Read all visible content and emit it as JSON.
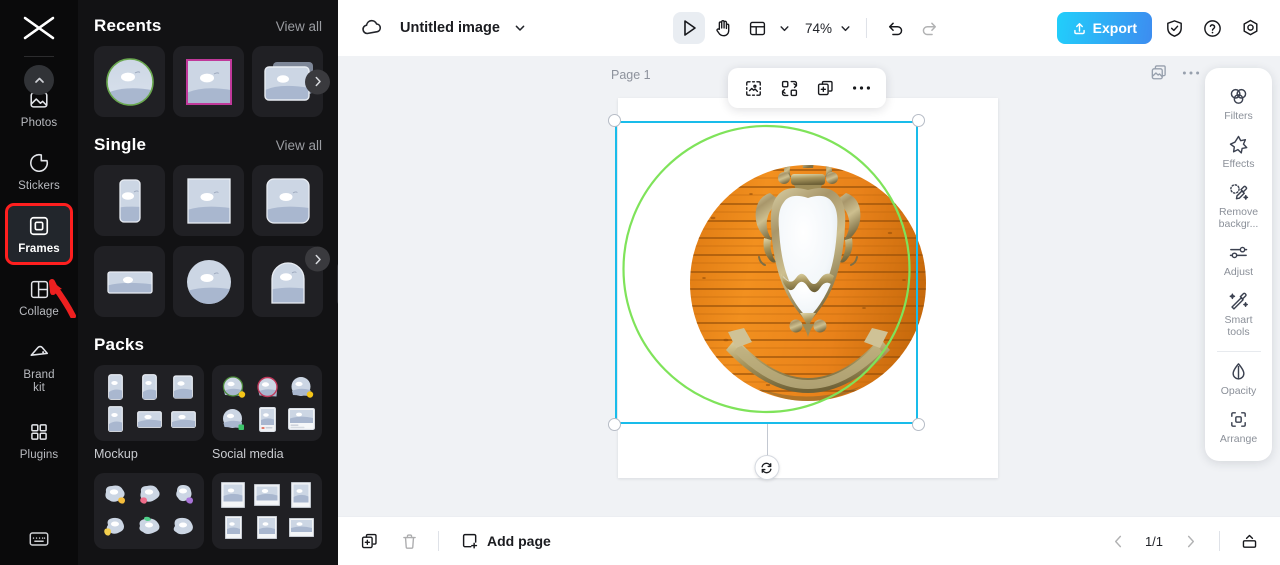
{
  "rail": {
    "logo_name": "capcut-logo",
    "items": [
      {
        "id": "photos",
        "label": "Photos",
        "icon": "photo-icon",
        "badge": "chevron-up-icon",
        "active": false
      },
      {
        "id": "stickers",
        "label": "Stickers",
        "icon": "sticker-icon",
        "active": false
      },
      {
        "id": "frames",
        "label": "Frames",
        "icon": "frame-icon",
        "active": true,
        "highlight_color": "#ff1f1f"
      },
      {
        "id": "collage",
        "label": "Collage",
        "icon": "collage-icon",
        "active": false
      },
      {
        "id": "brandkit",
        "label": "Brand\nkit",
        "label_line1": "Brand",
        "label_line2": "kit",
        "icon": "brand-kit-icon",
        "active": false
      },
      {
        "id": "plugins",
        "label": "Plugins",
        "icon": "plugins-grid-icon",
        "active": false
      },
      {
        "id": "keyboard",
        "label": "",
        "icon": "keyboard-icon",
        "active": false
      }
    ]
  },
  "panel": {
    "sections": [
      {
        "id": "recents",
        "title": "Recents",
        "view_all": "View all",
        "thumbs": [
          {
            "shape": "circle",
            "accent": "#6aa84f"
          },
          {
            "shape": "square",
            "accent": "#c0399a"
          },
          {
            "shape": "stack",
            "accent": "none"
          }
        ],
        "has_next": true
      },
      {
        "id": "single",
        "title": "Single",
        "view_all": "View all",
        "thumbs": [
          {
            "shape": "portrait"
          },
          {
            "shape": "square"
          },
          {
            "shape": "rounded-square"
          },
          {
            "shape": "landscape"
          },
          {
            "shape": "circle"
          },
          {
            "shape": "arch"
          }
        ],
        "has_next": true
      },
      {
        "id": "packs",
        "title": "Packs",
        "view_all": "",
        "packs": [
          {
            "id": "mockup",
            "label": "Mockup"
          },
          {
            "id": "social-media",
            "label": "Social media"
          },
          {
            "id": "blob",
            "label": ""
          },
          {
            "id": "polaroid",
            "label": ""
          }
        ]
      }
    ],
    "collapse_icon": "chevron-left-icon"
  },
  "topbar": {
    "cloud_icon": "cloud-save-icon",
    "title": "Untitled image",
    "title_dropdown_icon": "chevron-down-icon",
    "tools": [
      {
        "id": "select",
        "icon": "cursor-arrow-icon",
        "active": true
      },
      {
        "id": "hand",
        "icon": "hand-icon",
        "active": false
      },
      {
        "id": "layout",
        "icon": "layout-icon",
        "active": false,
        "dropdown_icon": "chevron-down-icon"
      }
    ],
    "zoom": "74%",
    "zoom_dropdown_icon": "chevron-down-icon",
    "undo_icon": "undo-icon",
    "redo_icon": "redo-icon",
    "redo_disabled": true,
    "export_label": "Export",
    "export_icon": "upload-icon",
    "export_gradient_from": "#21cffb",
    "export_gradient_to": "#3d8cf0",
    "right_icons": [
      {
        "id": "shield",
        "icon": "shield-check-icon"
      },
      {
        "id": "help",
        "icon": "question-circle-icon"
      },
      {
        "id": "settings",
        "icon": "gear-icon"
      }
    ]
  },
  "canvas": {
    "page_label": "Page 1",
    "page_tools": [
      {
        "id": "duplicate-page",
        "icon": "duplicate-image-icon"
      },
      {
        "id": "page-more",
        "icon": "more-horizontal-icon"
      }
    ],
    "floating_toolbar": [
      {
        "id": "replace-image",
        "icon": "replace-image-icon"
      },
      {
        "id": "swap-frame",
        "icon": "swap-icon"
      },
      {
        "id": "duplicate",
        "icon": "duplicate-icon"
      },
      {
        "id": "more",
        "icon": "more-horizontal-icon"
      }
    ],
    "selection": {
      "border_color": "#19bcea",
      "frame_outline_color": "#7fe35a",
      "rotate_icon": "rotate-icon"
    },
    "artwork": {
      "description": "Circular framed photo of an ornate brass heraldic shield crest with fleur-de-lis crown and banner scroll mounted on orange wooden plank wall",
      "background_color": "#e07b1c",
      "plank_color": "#ef8f22",
      "shield_color": "#f2f6f8",
      "metal_color": "#b3a072"
    }
  },
  "dock": {
    "items": [
      {
        "id": "filters",
        "label": "Filters",
        "icon": "filters-circles-icon"
      },
      {
        "id": "effects",
        "label": "Effects",
        "icon": "effects-star-icon"
      },
      {
        "id": "remove-background",
        "label": "Remove\nbackgr...",
        "label_line1": "Remove",
        "label_line2": "backgr...",
        "icon": "remove-background-icon"
      },
      {
        "id": "adjust",
        "label": "Adjust",
        "icon": "sliders-icon"
      },
      {
        "id": "smart-tools",
        "label": "Smart\ntools",
        "label_line1": "Smart",
        "label_line2": "tools",
        "icon": "magic-wand-icon"
      },
      {
        "id": "opacity",
        "label": "Opacity",
        "icon": "opacity-droplet-icon"
      },
      {
        "id": "arrange",
        "label": "Arrange",
        "icon": "arrange-icon"
      }
    ],
    "separator_after": "smart-tools"
  },
  "bottombar": {
    "duplicate_icon": "duplicate-page-icon",
    "delete_icon": "trash-icon",
    "delete_disabled": true,
    "add_page_label": "Add page",
    "add_page_icon": "add-page-icon",
    "prev_icon": "chevron-left-icon",
    "page_indicator": "1/1",
    "next_icon": "chevron-right-icon",
    "pages_panel_icon": "pages-panel-icon"
  }
}
